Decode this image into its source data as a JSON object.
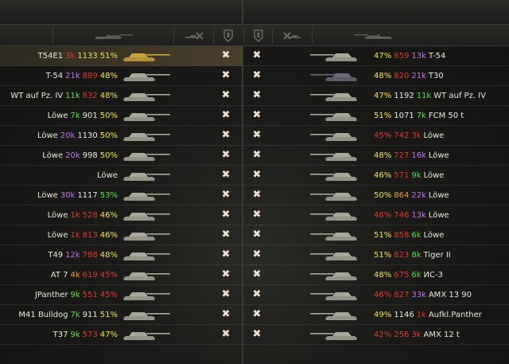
{
  "colors": {
    "red": "#e23a2e",
    "orange": "#f39a2e",
    "yellow": "#f2e44a",
    "green": "#5de043",
    "purple": "#c473f0",
    "white": "#e8e8e0",
    "self_tank": "#c8a43a",
    "tank_default": "#a8a89a",
    "tank_dark": "#6a6a78"
  },
  "header": {
    "left_icons": [
      "tank-silhouette-icon",
      "vehicle-destroyed-icon",
      "shield-icon"
    ],
    "right_icons": [
      "shield-icon",
      "vehicle-destroyed-icon",
      "tank-silhouette-icon"
    ]
  },
  "left_team": [
    {
      "name": "T54E1",
      "battles": "3k",
      "battles_color": "red",
      "rating": "1133",
      "rating_color": "yellow",
      "winrate": "51%",
      "winrate_color": "yellow",
      "status": "destroyed",
      "self": true
    },
    {
      "name": "T-54",
      "battles": "21k",
      "battles_color": "purple",
      "rating": "889",
      "rating_color": "red",
      "winrate": "48%",
      "winrate_color": "yellow",
      "status": "destroyed"
    },
    {
      "name": "WT auf Pz. IV",
      "battles": "11k",
      "battles_color": "green",
      "rating": "832",
      "rating_color": "red",
      "winrate": "48%",
      "winrate_color": "yellow",
      "status": "destroyed"
    },
    {
      "name": "Löwe",
      "battles": "7k",
      "battles_color": "green",
      "rating": "901",
      "rating_color": "white",
      "winrate": "50%",
      "winrate_color": "yellow",
      "status": "destroyed"
    },
    {
      "name": "Löwe",
      "battles": "20k",
      "battles_color": "purple",
      "rating": "1130",
      "rating_color": "white",
      "winrate": "50%",
      "winrate_color": "yellow",
      "status": "destroyed"
    },
    {
      "name": "Löwe",
      "battles": "20k",
      "battles_color": "purple",
      "rating": "998",
      "rating_color": "white",
      "winrate": "50%",
      "winrate_color": "yellow",
      "status": "destroyed"
    },
    {
      "name": "Löwe",
      "battles": "",
      "battles_color": "white",
      "rating": "",
      "rating_color": "white",
      "winrate": "",
      "winrate_color": "white",
      "status": "destroyed"
    },
    {
      "name": "Löwe",
      "battles": "30k",
      "battles_color": "purple",
      "rating": "1117",
      "rating_color": "white",
      "winrate": "53%",
      "winrate_color": "green",
      "status": "destroyed"
    },
    {
      "name": "Löwe",
      "battles": "1k",
      "battles_color": "red",
      "rating": "528",
      "rating_color": "red",
      "winrate": "46%",
      "winrate_color": "yellow",
      "status": "destroyed"
    },
    {
      "name": "Löwe",
      "battles": "1k",
      "battles_color": "red",
      "rating": "813",
      "rating_color": "red",
      "winrate": "46%",
      "winrate_color": "yellow",
      "status": "destroyed"
    },
    {
      "name": "T49",
      "battles": "12k",
      "battles_color": "purple",
      "rating": "788",
      "rating_color": "red",
      "winrate": "48%",
      "winrate_color": "yellow",
      "status": "destroyed"
    },
    {
      "name": "AT 7",
      "battles": "4k",
      "battles_color": "orange",
      "rating": "619",
      "rating_color": "red",
      "winrate": "45%",
      "winrate_color": "red",
      "status": "destroyed"
    },
    {
      "name": "JPanther",
      "battles": "9k",
      "battles_color": "green",
      "rating": "551",
      "rating_color": "red",
      "winrate": "45%",
      "winrate_color": "red",
      "status": "destroyed"
    },
    {
      "name": "M41 Bulldog",
      "battles": "7k",
      "battles_color": "green",
      "rating": "911",
      "rating_color": "white",
      "winrate": "51%",
      "winrate_color": "yellow",
      "status": "destroyed"
    },
    {
      "name": "T37",
      "battles": "9k",
      "battles_color": "green",
      "rating": "573",
      "rating_color": "red",
      "winrate": "47%",
      "winrate_color": "yellow",
      "status": "destroyed"
    }
  ],
  "right_team": [
    {
      "name": "T-54",
      "winrate": "47%",
      "winrate_color": "yellow",
      "rating": "659",
      "rating_color": "red",
      "battles": "13k",
      "battles_color": "purple",
      "status": "destroyed"
    },
    {
      "name": "T30",
      "winrate": "48%",
      "winrate_color": "yellow",
      "rating": "820",
      "rating_color": "red",
      "battles": "21k",
      "battles_color": "purple",
      "status": "destroyed",
      "dark": true
    },
    {
      "name": "WT auf Pz. IV",
      "winrate": "47%",
      "winrate_color": "yellow",
      "rating": "1192",
      "rating_color": "white",
      "battles": "11k",
      "battles_color": "green",
      "status": "destroyed"
    },
    {
      "name": "FCM 50 t",
      "winrate": "51%",
      "winrate_color": "yellow",
      "rating": "1071",
      "rating_color": "white",
      "battles": "7k",
      "battles_color": "green",
      "status": "destroyed"
    },
    {
      "name": "Löwe",
      "winrate": "45%",
      "winrate_color": "red",
      "rating": "742",
      "rating_color": "red",
      "battles": "3k",
      "battles_color": "red",
      "status": "destroyed"
    },
    {
      "name": "Löwe",
      "winrate": "48%",
      "winrate_color": "yellow",
      "rating": "727",
      "rating_color": "red",
      "battles": "16k",
      "battles_color": "purple",
      "status": "destroyed"
    },
    {
      "name": "Löwe",
      "winrate": "46%",
      "winrate_color": "yellow",
      "rating": "571",
      "rating_color": "red",
      "battles": "9k",
      "battles_color": "green",
      "status": "destroyed"
    },
    {
      "name": "Löwe",
      "winrate": "50%",
      "winrate_color": "yellow",
      "rating": "864",
      "rating_color": "orange",
      "battles": "22k",
      "battles_color": "purple",
      "status": "destroyed"
    },
    {
      "name": "Löwe",
      "winrate": "46%",
      "winrate_color": "red",
      "rating": "746",
      "rating_color": "red",
      "battles": "13k",
      "battles_color": "purple",
      "status": "destroyed"
    },
    {
      "name": "Löwe",
      "winrate": "51%",
      "winrate_color": "yellow",
      "rating": "858",
      "rating_color": "red",
      "battles": "6k",
      "battles_color": "green",
      "status": "destroyed"
    },
    {
      "name": "Tiger II",
      "winrate": "51%",
      "winrate_color": "yellow",
      "rating": "823",
      "rating_color": "red",
      "battles": "8k",
      "battles_color": "green",
      "status": "destroyed"
    },
    {
      "name": "ИС-3",
      "winrate": "48%",
      "winrate_color": "yellow",
      "rating": "675",
      "rating_color": "red",
      "battles": "6k",
      "battles_color": "green",
      "status": "destroyed"
    },
    {
      "name": "AMX 13 90",
      "winrate": "46%",
      "winrate_color": "red",
      "rating": "827",
      "rating_color": "red",
      "battles": "33k",
      "battles_color": "purple",
      "status": "destroyed"
    },
    {
      "name": "Aufkl.Panther",
      "winrate": "49%",
      "winrate_color": "yellow",
      "rating": "1146",
      "rating_color": "white",
      "battles": "1k",
      "battles_color": "red",
      "status": "destroyed"
    },
    {
      "name": "AMX 12 t",
      "winrate": "42%",
      "winrate_color": "red",
      "rating": "256",
      "rating_color": "red",
      "battles": "3k",
      "battles_color": "red",
      "status": "destroyed"
    }
  ]
}
